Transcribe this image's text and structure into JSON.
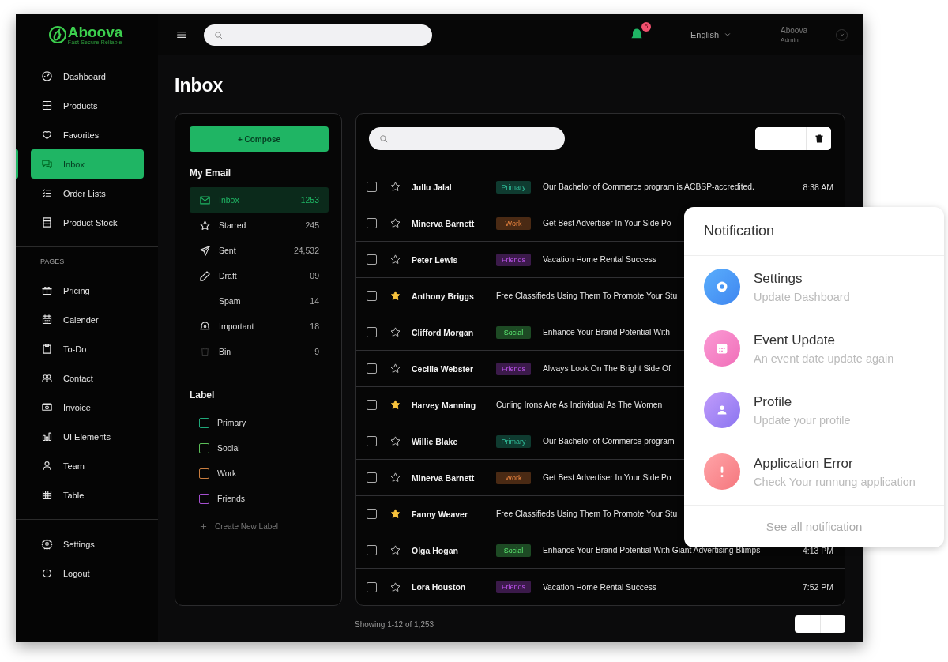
{
  "sidebar": {
    "logo": {
      "name": "Aboova",
      "tagline": "Fast Secure Reliable"
    },
    "items": [
      {
        "label": "Dashboard",
        "selected": false
      },
      {
        "label": "Products",
        "selected": false
      },
      {
        "label": "Favorites",
        "selected": false
      },
      {
        "label": "Inbox",
        "selected": true
      },
      {
        "label": "Order Lists",
        "selected": false
      },
      {
        "label": "Product Stock",
        "selected": false
      }
    ],
    "pages_heading": "PAGES",
    "pages": [
      {
        "label": "Pricing",
        "selected": false
      },
      {
        "label": "Calender",
        "selected": false
      },
      {
        "label": "To-Do",
        "selected": false
      },
      {
        "label": "Contact",
        "selected": false
      },
      {
        "label": "Invoice",
        "selected": false
      },
      {
        "label": "UI Elements",
        "selected": false
      },
      {
        "label": "Team",
        "selected": false
      },
      {
        "label": "Table",
        "selected": false
      }
    ],
    "footer_items": [
      {
        "label": "Settings",
        "selected": false
      },
      {
        "label": "Logout",
        "selected": false
      }
    ]
  },
  "topbar": {
    "notification_count": "6",
    "language": "English",
    "user": {
      "name": "Aboova",
      "role": "Admin"
    }
  },
  "page_title": "Inbox",
  "mail_nav": {
    "compose": "+ Compose",
    "my_email_heading": "My Email",
    "folders": [
      {
        "label": "Inbox",
        "count": "1253",
        "selected": true
      },
      {
        "label": "Starred",
        "count": "245",
        "selected": false
      },
      {
        "label": "Sent",
        "count": "24,532",
        "selected": false
      },
      {
        "label": "Draft",
        "count": "09",
        "selected": false
      },
      {
        "label": "Spam",
        "count": "14",
        "selected": false
      },
      {
        "label": "Important",
        "count": "18",
        "selected": false
      },
      {
        "label": "Bin",
        "count": "9",
        "selected": false
      }
    ],
    "label_heading": "Label",
    "labels": [
      {
        "label": "Primary",
        "color": "#1fa87a"
      },
      {
        "label": "Social",
        "color": "#5cbf58"
      },
      {
        "label": "Work",
        "color": "#c97d3f"
      },
      {
        "label": "Friends",
        "color": "#a54fd0"
      }
    ],
    "create_label": "Create New Label"
  },
  "emails": [
    {
      "sender": "Jullu Jalal",
      "tag": {
        "text": "Primary",
        "color": "#0f3b30"
      },
      "subject": "Our Bachelor of Commerce program is ACBSP-accredited.",
      "time": "8:38 AM",
      "starred": false,
      "checked": false
    },
    {
      "sender": "Minerva Barnett",
      "tag": {
        "text": "Work",
        "color": "#4a2a14"
      },
      "subject": "Get Best Advertiser In Your Side Po",
      "starred": false,
      "checked": false
    },
    {
      "sender": "Peter Lewis",
      "tag": {
        "text": "Friends",
        "color": "#3b1a4a"
      },
      "subject": "Vacation Home Rental Success",
      "starred": false,
      "checked": false
    },
    {
      "sender": "Anthony Briggs",
      "subject": "Free Classifieds Using Them To Promote Your Stu",
      "starred": true,
      "checked": false
    },
    {
      "sender": "Clifford Morgan",
      "tag": {
        "text": "Social",
        "color": "#1d4a24"
      },
      "subject": "Enhance Your Brand Potential With",
      "starred": false,
      "checked": false
    },
    {
      "sender": "Cecilia Webster",
      "tag": {
        "text": "Friends",
        "color": "#3b1a4a"
      },
      "subject": "Always Look On The Bright Side Of",
      "starred": false,
      "checked": false
    },
    {
      "sender": "Harvey Manning",
      "subject": "Curling Irons Are As Individual As The Women",
      "starred": true,
      "checked": false
    },
    {
      "sender": "Willie Blake",
      "tag": {
        "text": "Primary",
        "color": "#0f3b30"
      },
      "subject": "Our Bachelor of Commerce program",
      "starred": false,
      "checked": false
    },
    {
      "sender": "Minerva Barnett",
      "tag": {
        "text": "Work",
        "color": "#4a2a14"
      },
      "subject": "Get Best Advertiser In Your Side Po",
      "starred": false,
      "checked": false
    },
    {
      "sender": "Fanny Weaver",
      "subject": "Free Classifieds Using Them To Promote Your Stu",
      "starred": true,
      "checked": false
    },
    {
      "sender": "Olga Hogan",
      "tag": {
        "text": "Social",
        "color": "#1d4a24"
      },
      "subject": "Enhance Your Brand Potential With Giant Advertising Blimps",
      "time": "4:13 PM",
      "starred": false,
      "checked": false
    },
    {
      "sender": "Lora Houston",
      "tag": {
        "text": "Friends",
        "color": "#3b1a4a"
      },
      "subject": "Vacation Home Rental Success",
      "time": "7:52 PM",
      "starred": false,
      "checked": false
    }
  ],
  "footer": {
    "showing": "Showing 1-12 of 1,253"
  },
  "notifications": {
    "title": "Notification",
    "items": [
      {
        "kind": "settings",
        "title": "Settings",
        "subtitle": "Update Dashboard"
      },
      {
        "kind": "event",
        "title": "Event Update",
        "subtitle": "An event date update again"
      },
      {
        "kind": "profile",
        "title": "Profile",
        "subtitle": "Update your profile"
      },
      {
        "kind": "error",
        "title": "Application Error",
        "subtitle": "Check Your runnung application"
      }
    ],
    "see_all": "See all notification"
  }
}
